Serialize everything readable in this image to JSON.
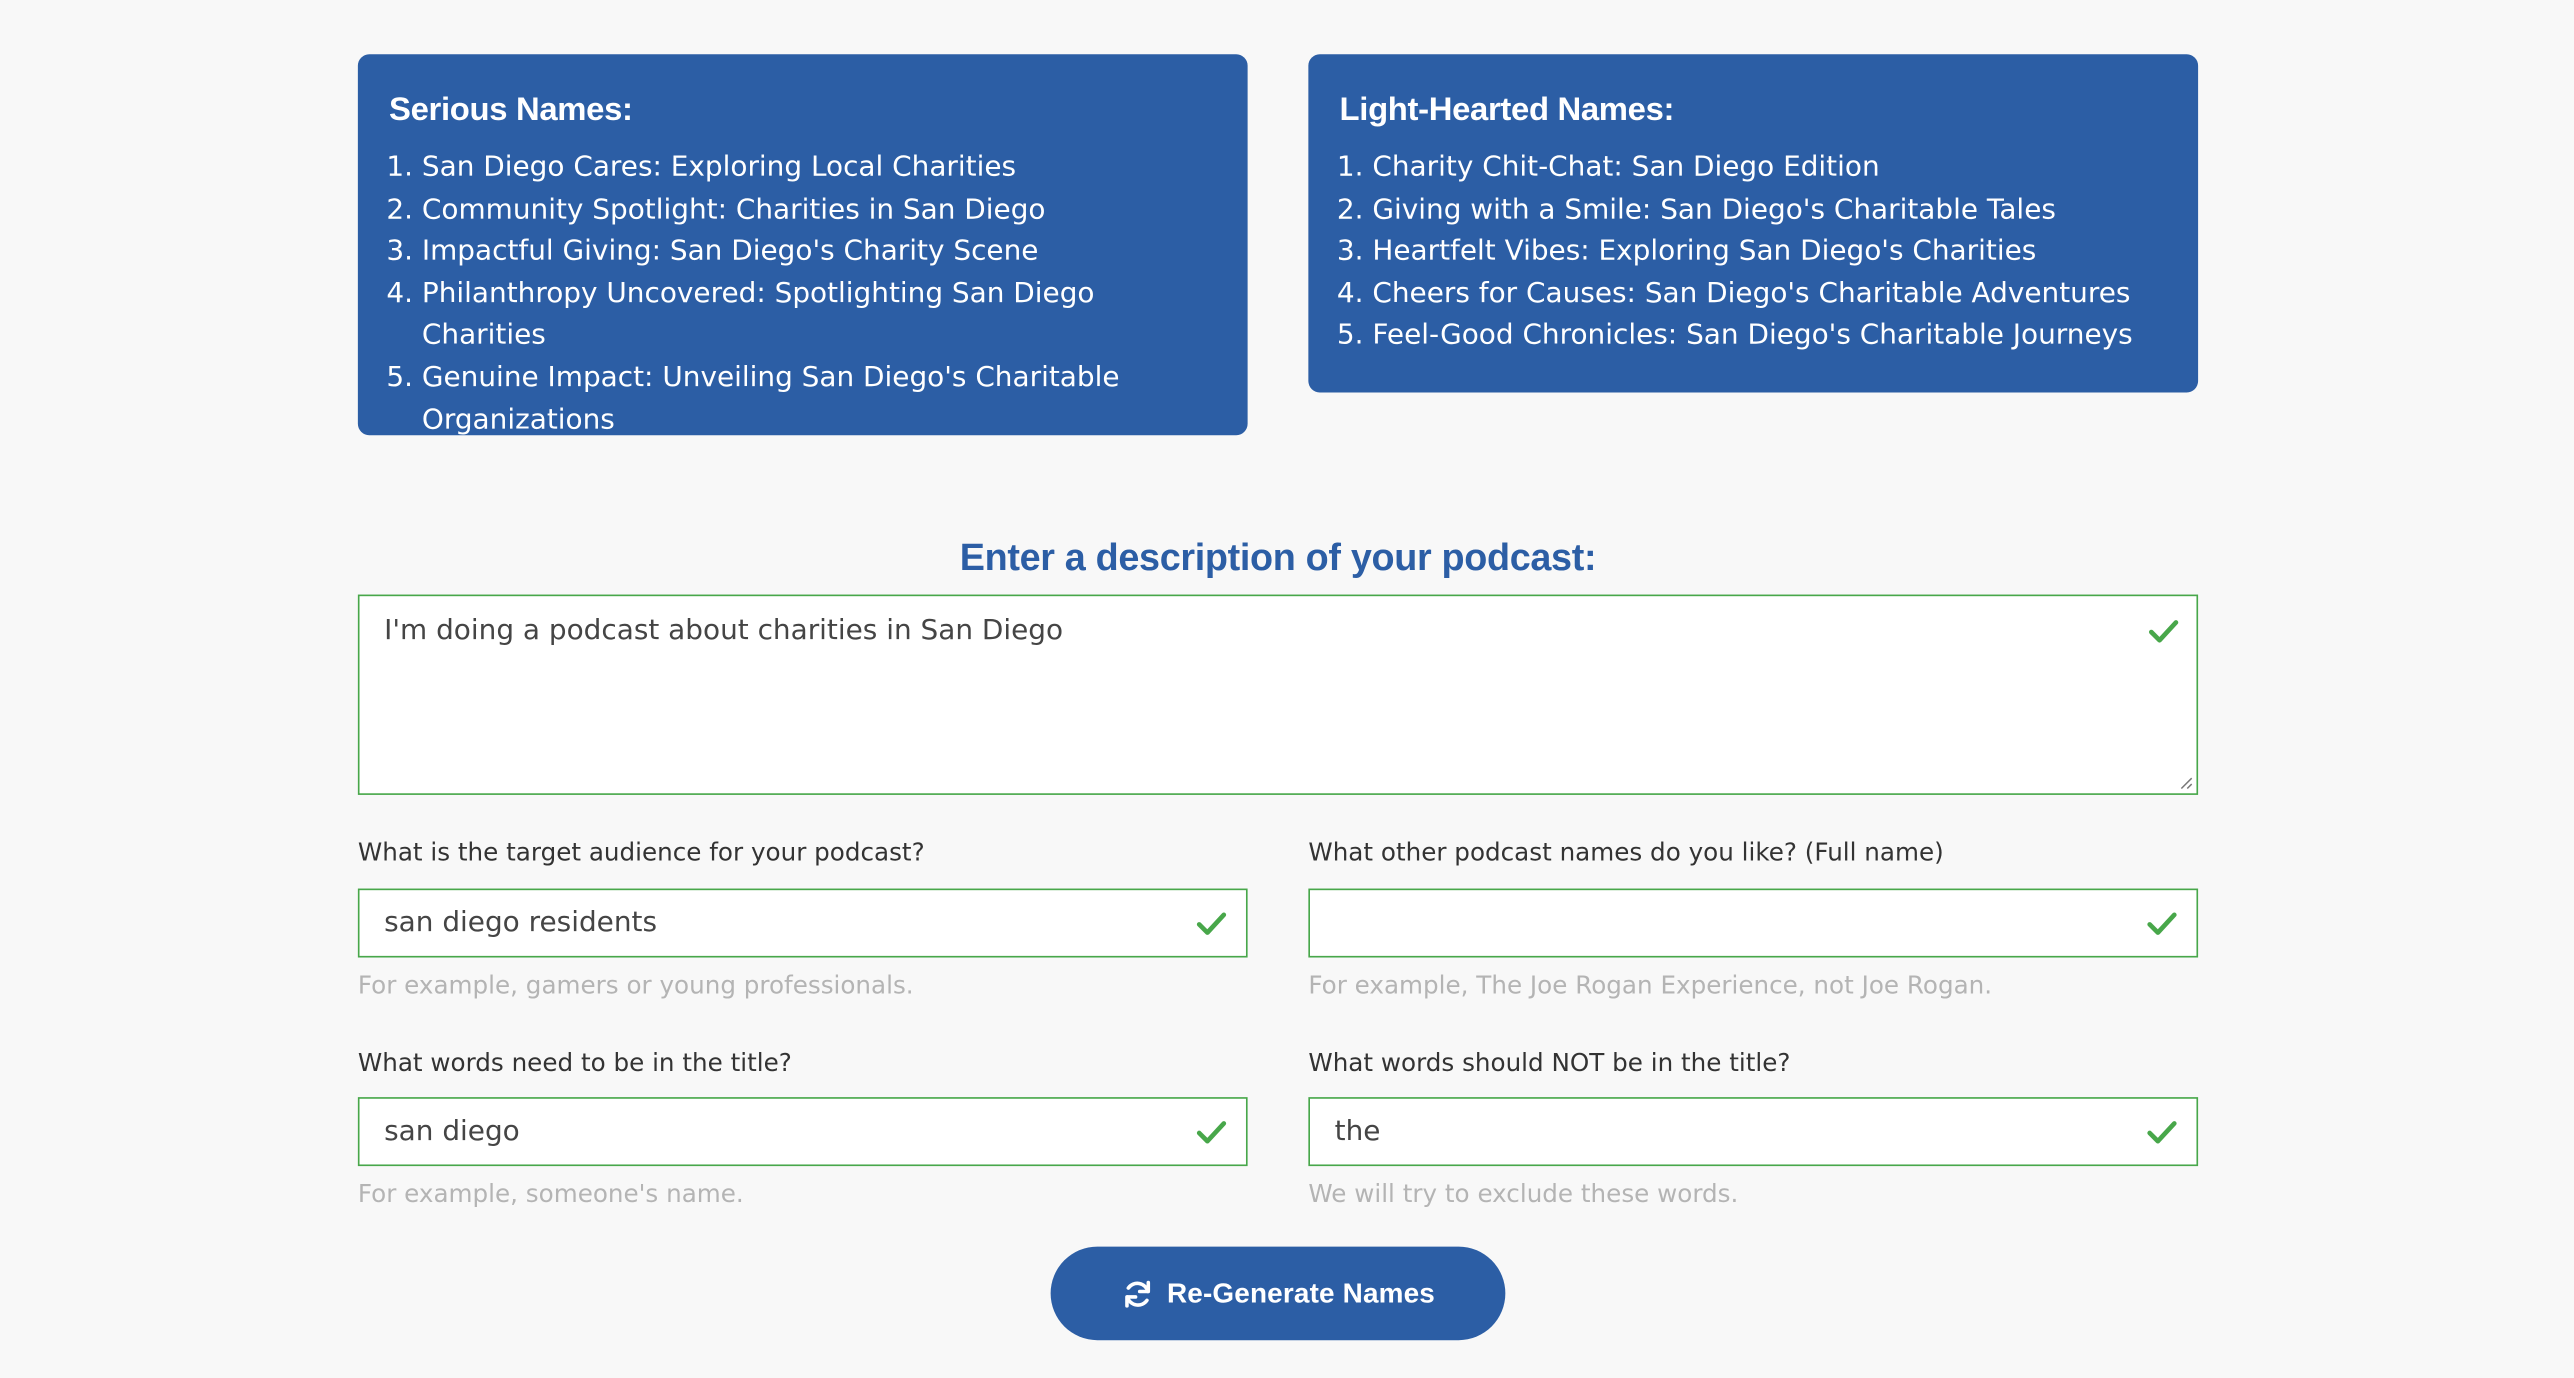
{
  "serious": {
    "title": "Serious Names:",
    "items": [
      "San Diego Cares: Exploring Local Charities",
      "Community Spotlight: Charities in San Diego",
      "Impactful Giving: San Diego's Charity Scene",
      "Philanthropy Uncovered: Spotlighting San Diego Charities",
      "Genuine Impact: Unveiling San Diego's Charitable Organizations"
    ]
  },
  "light": {
    "title": "Light-Hearted Names:",
    "items": [
      "Charity Chit-Chat: San Diego Edition",
      "Giving with a Smile: San Diego's Charitable Tales",
      "Heartfelt Vibes: Exploring San Diego's Charities",
      "Cheers for Causes: San Diego's Charitable Adventures",
      "Feel-Good Chronicles: San Diego's Charitable Journeys"
    ]
  },
  "form": {
    "heading": "Enter a description of your podcast:",
    "description_value": "I'm doing a podcast about charities in San Diego",
    "audience": {
      "label": "What is the target audience for your podcast?",
      "value": "san diego residents",
      "help": "For example, gamers or young professionals."
    },
    "liked_names": {
      "label": "What other podcast names do you like? (Full name)",
      "value": "",
      "help": "For example, The Joe Rogan Experience, not Joe Rogan."
    },
    "include_words": {
      "label": "What words need to be in the title?",
      "value": "san diego",
      "help": "For example, someone's name."
    },
    "exclude_words": {
      "label": "What words should NOT be in the title?",
      "value": "the",
      "help": "We will try to exclude these words."
    },
    "button_label": "Re-Generate Names"
  },
  "colors": {
    "brand_blue": "#2c5ea5",
    "valid_green": "#48a74a",
    "help_gray": "#b4b4b4"
  },
  "icons": {
    "valid": "check-icon",
    "regenerate": "refresh-icon"
  }
}
